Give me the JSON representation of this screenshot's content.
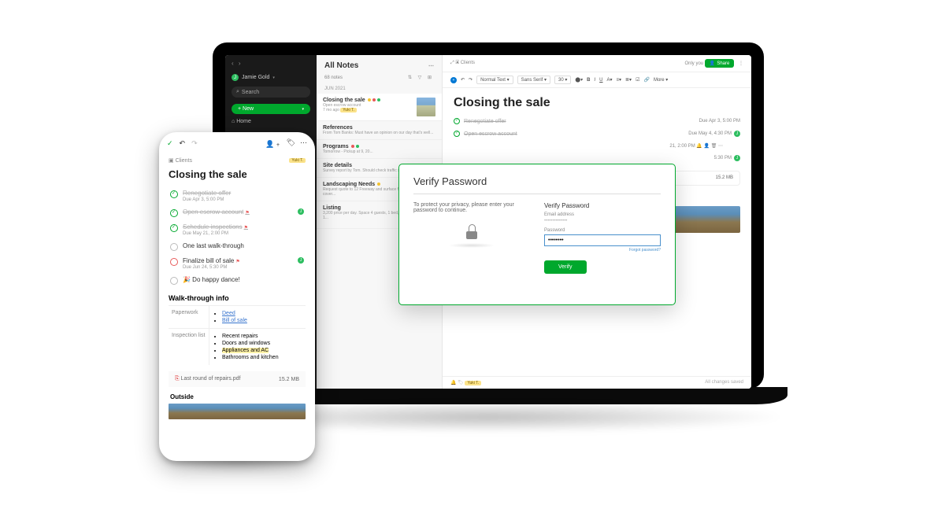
{
  "sidebar": {
    "user_initial": "J",
    "user_name": "Jamie Gold",
    "search_placeholder": "Search",
    "new_label": "New",
    "home_label": "Home"
  },
  "notelist": {
    "header": "All Notes",
    "count": "68 notes",
    "month": "JUN 2021",
    "items": [
      {
        "title": "Closing the sale",
        "meta1": "Open escrow account",
        "meta2": "7 mo ago",
        "tag": "Yuki T."
      },
      {
        "title": "References",
        "meta1": "From Tom Banks: Must have an opinion on our day that's well...",
        "meta2": ""
      },
      {
        "title": "Programs",
        "meta1": "",
        "meta2": "Tomorrow - Pickup at 9, 20..."
      },
      {
        "title": "Site details",
        "meta1": "Survey report by Tom. Should check traffic score...",
        "meta2": ""
      },
      {
        "title": "Landscaping Needs",
        "meta1": "Request quote to 12 Freeway and surface friendly ground cover...",
        "meta2": ""
      },
      {
        "title": "Listing",
        "meta1": "3,200 price per day. Space 4 guests, 1 bed, Private 1...",
        "meta2": ""
      }
    ]
  },
  "editor": {
    "breadcrumb_icon": "☐",
    "breadcrumb": "Clients",
    "only_you": "Only you",
    "share": "Share",
    "more": "More",
    "toolbar": {
      "style": "Normal Text",
      "font": "Sans Serif",
      "size": "30"
    },
    "title": "Closing the sale",
    "tasks": [
      {
        "text": "Renegotiate offer",
        "due": "Due Apr 3, 5:00 PM",
        "done": true,
        "assignee": ""
      },
      {
        "text": "Open escrow account",
        "due": "Due May 4, 4:30 PM",
        "done": true,
        "assignee": "J"
      },
      {
        "text": "",
        "due": "21, 2:00 PM",
        "done": false,
        "assignee": ""
      },
      {
        "text": "",
        "due": "5:30 PM",
        "done": false,
        "assignee": "J"
      }
    ],
    "attachment": {
      "name": "Last round of repairs.pdf",
      "size": "15.2 MB"
    },
    "section_outside": "Outside",
    "footer_user": "Yuki T.",
    "footer_status": "All changes saved"
  },
  "modal": {
    "title": "Verify Password",
    "prompt": "To protect your privacy, please enter your password to continue.",
    "subtitle": "Verify Password",
    "email_label": "Email address",
    "email_value": "••••••••••••••",
    "password_label": "Password",
    "password_value": "••••••••",
    "forgot": "Forgot password?",
    "verify_button": "Verify"
  },
  "phone": {
    "breadcrumb": "Clients",
    "assignee_tag": "Yuki T.",
    "title": "Closing the sale",
    "tasks": [
      {
        "text": "Renegotiate offer",
        "due": "Due Apr 3, 5:00 PM",
        "done": true,
        "flag": false,
        "assignee": ""
      },
      {
        "text": "Open escrow account",
        "due": "",
        "done": true,
        "flag": true,
        "assignee": "J"
      },
      {
        "text": "Schedule inspections",
        "due": "Due May 21, 2:00 PM",
        "done": true,
        "flag": true,
        "assignee": ""
      },
      {
        "text": "One last walk-through",
        "due": "",
        "done": false,
        "flag": false,
        "assignee": ""
      },
      {
        "text": "Finalize bill of sale",
        "due": "Due Jun 24, 5:30 PM",
        "done": false,
        "flag": true,
        "assignee": "J"
      },
      {
        "text": "🎉 Do happy dance!",
        "due": "",
        "done": false,
        "flag": false,
        "assignee": ""
      }
    ],
    "section_walk": "Walk-through info",
    "rows": [
      {
        "label": "Paperwork",
        "items": [
          "Deed",
          "Bill of sale"
        ]
      },
      {
        "label": "Inspection list",
        "items": [
          "Recent repairs",
          "Doors and windows",
          "Appliances and AC",
          "Bathrooms and kitchen"
        ]
      }
    ],
    "attachment": {
      "name": "Last round of repairs.pdf",
      "size": "15.2 MB"
    },
    "section_outside": "Outside"
  }
}
